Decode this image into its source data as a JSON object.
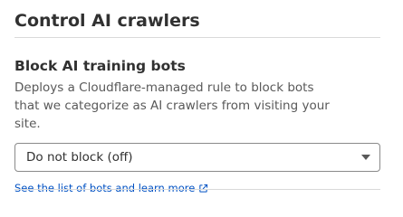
{
  "section": {
    "title": "Control AI crawlers"
  },
  "setting": {
    "title": "Block AI training bots",
    "description": "Deploys a Cloudflare-managed rule to block bots that we categorize as AI crawlers from visiting your site.",
    "select": {
      "selected": "Do not block (off)",
      "icon": "chevron-down-icon"
    },
    "link": {
      "label": "See the list of bots and learn more",
      "icon": "external-link-icon"
    }
  },
  "colors": {
    "text": "#313131",
    "muted": "#595959",
    "link": "#0051c3",
    "divider": "#d9d9d9",
    "border": "#8a8a8a"
  }
}
